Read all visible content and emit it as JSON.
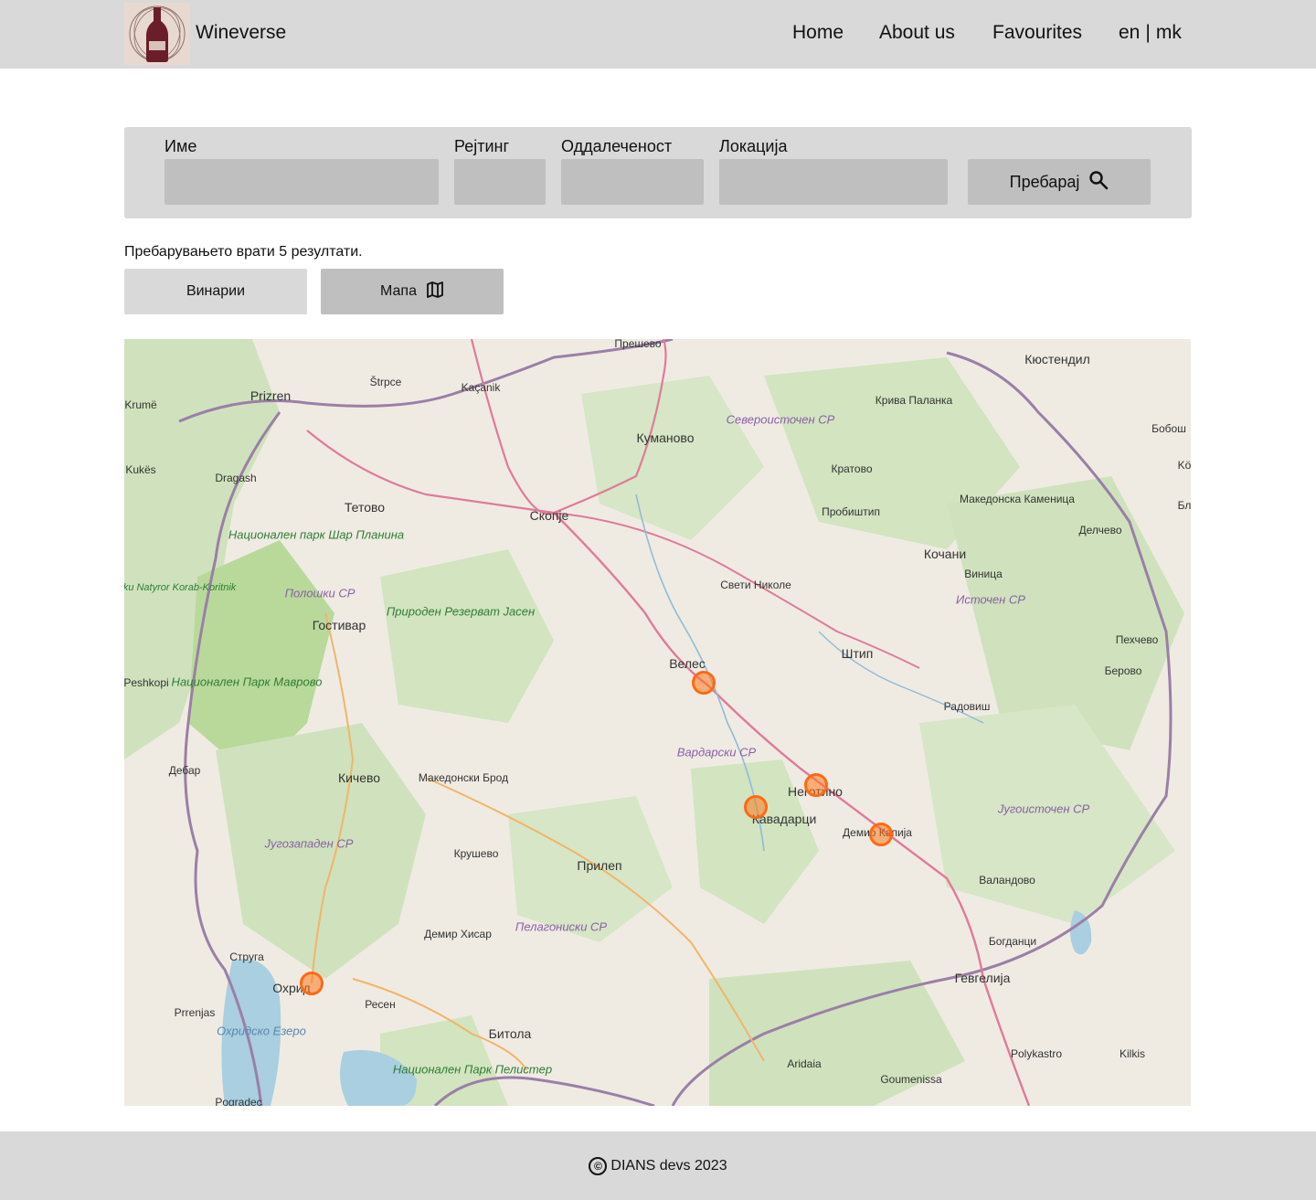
{
  "header": {
    "brand": "Wineverse",
    "nav": {
      "home": "Home",
      "about": "About us",
      "favourites": "Favourites"
    },
    "lang": {
      "en": "en",
      "separator": "|",
      "mk": "mk"
    }
  },
  "search": {
    "name_label": "Име",
    "rating_label": "Рејтинг",
    "distance_label": "Оддалеченост",
    "location_label": "Локација",
    "button_label": "Пребарај",
    "name_value": "",
    "rating_value": "",
    "distance_value": "",
    "location_value": ""
  },
  "results_text": "Пребарувањето врати 5 резултати.",
  "view_tabs": {
    "wineries": "Винарии",
    "map": "Мапа"
  },
  "map": {
    "places": [
      "Прешево",
      "Kaçanik",
      "Štrpce",
      "Prizren",
      "Krumë",
      "Kukës",
      "Dragash",
      "Куманово",
      "Кюстендил",
      "Крива Паланка",
      "Северoисточен СР",
      "Кратово",
      "Тетово",
      "Скопје",
      "Пробиштип",
      "Македонска Каменица",
      "Делчево",
      "Кочани",
      "Виница",
      "Источен СР",
      "Свети Николе",
      "Гостивар",
      "Полошки СР",
      "Природен Резерват Јасен",
      "Национален парк Шар Планина",
      "Parku Natyror Korab-Koritnik",
      "Национален Парк Маврово",
      "Peshkopi",
      "Велес",
      "Штип",
      "Пехчево",
      "Берово",
      "Радовиш",
      "Вардарски СР",
      "Дебар",
      "Кичево",
      "Македонски Брод",
      "Неготино",
      "Кавадарци",
      "Демир Капија",
      "Југоисточен СР",
      "Југозападен СР",
      "Крушево",
      "Прилеп",
      "Валандово",
      "Пелагониски СР",
      "Богданци",
      "Демир Хисар",
      "Струга",
      "Охрид",
      "Гевгелија",
      "Prrenjas",
      "Ресен",
      "Охридско Езеро",
      "Битола",
      "Национален Парк Пелистер",
      "Polykastro",
      "Kilkis",
      "Aridaia",
      "Goumenissa",
      "Pogradec",
      "Бобош",
      "Kö",
      "Бл"
    ],
    "marker_count": 5
  },
  "footer": {
    "copyright_symbol": "©",
    "text": "DIANS devs 2023"
  },
  "colors": {
    "header_bg": "#d9d9d9",
    "input_bg": "#bfbfbf",
    "marker": "#ff6a13"
  },
  "icons": {
    "search_button": "search-icon",
    "map_tab": "map-icon",
    "logo": "wine-bottle-icon"
  }
}
